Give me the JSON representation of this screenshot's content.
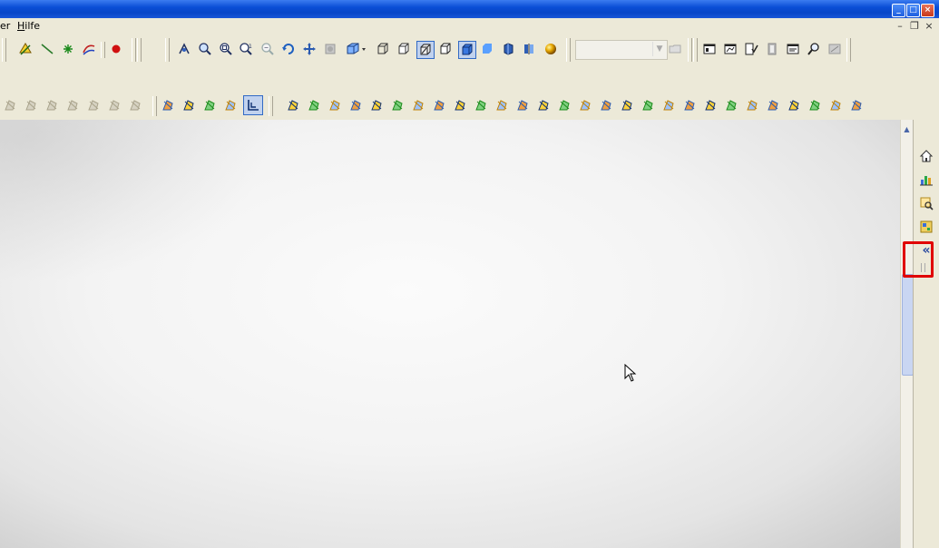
{
  "menubar": {
    "partial_item": "er",
    "hilfe_first": "H",
    "hilfe_rest": "ilfe"
  },
  "window_controls": {
    "minimize": "_",
    "maximize": "□",
    "close": "×"
  },
  "mdi_controls": {
    "minimize": "–",
    "restore": "❐",
    "close": "×"
  },
  "toolbar1": {
    "icons": [
      "sketch-plane-icon",
      "line-icon",
      "point-icon",
      "curve-icon",
      "record-icon",
      "view-orient-icon",
      "zoom-icon",
      "zoom-fit-icon",
      "zoom-area-icon",
      "zoom-out-icon",
      "rotate-icon",
      "pan-icon",
      "render-icon",
      "view-cube-icon",
      "wireframe-icon",
      "hidden-line-icon",
      "shaded-edges-icon",
      "no-hidden-icon",
      "shaded-icon",
      "shaded-solid-icon",
      "perspective-icon",
      "section-icon",
      "sphere-icon"
    ],
    "combo_value": ""
  },
  "toolbar2": {
    "icons": [
      "fe-icon-1",
      "fe-icon-2",
      "fe-icon-3",
      "fe-icon-4",
      "fe-icon-5",
      "fe-icon-6",
      "fe-icon-7",
      "surface-icon",
      "curve-tool-icon",
      "list-icon",
      "table-icon",
      "coordinate-icon",
      "filter-icon",
      "select-icon",
      "select-body-icon",
      "pick-icon",
      "node-icon",
      "beam-icon",
      "box-icon",
      "load-icon",
      "cube-icon",
      "vertex-icon",
      "edge-icon",
      "point-mesh-icon",
      "axis-icon",
      "constraint-icon",
      "rotate-mesh-icon",
      "mesh-icon",
      "check-icon",
      "check2-icon",
      "table2-icon",
      "graph-icon",
      "plot-icon",
      "cut-icon",
      "analysis-icon",
      "filter2-icon",
      "result-icon",
      "contour-icon",
      "probe-icon",
      "clip-icon"
    ]
  },
  "taskpane": {
    "buttons": [
      "home-icon",
      "chart-icon",
      "search-view-icon",
      "properties-icon",
      "collapse-icon"
    ],
    "collapse_label": "«"
  },
  "colors": {
    "highlight": "#e00000",
    "titlebar": "#0a4ed6"
  }
}
